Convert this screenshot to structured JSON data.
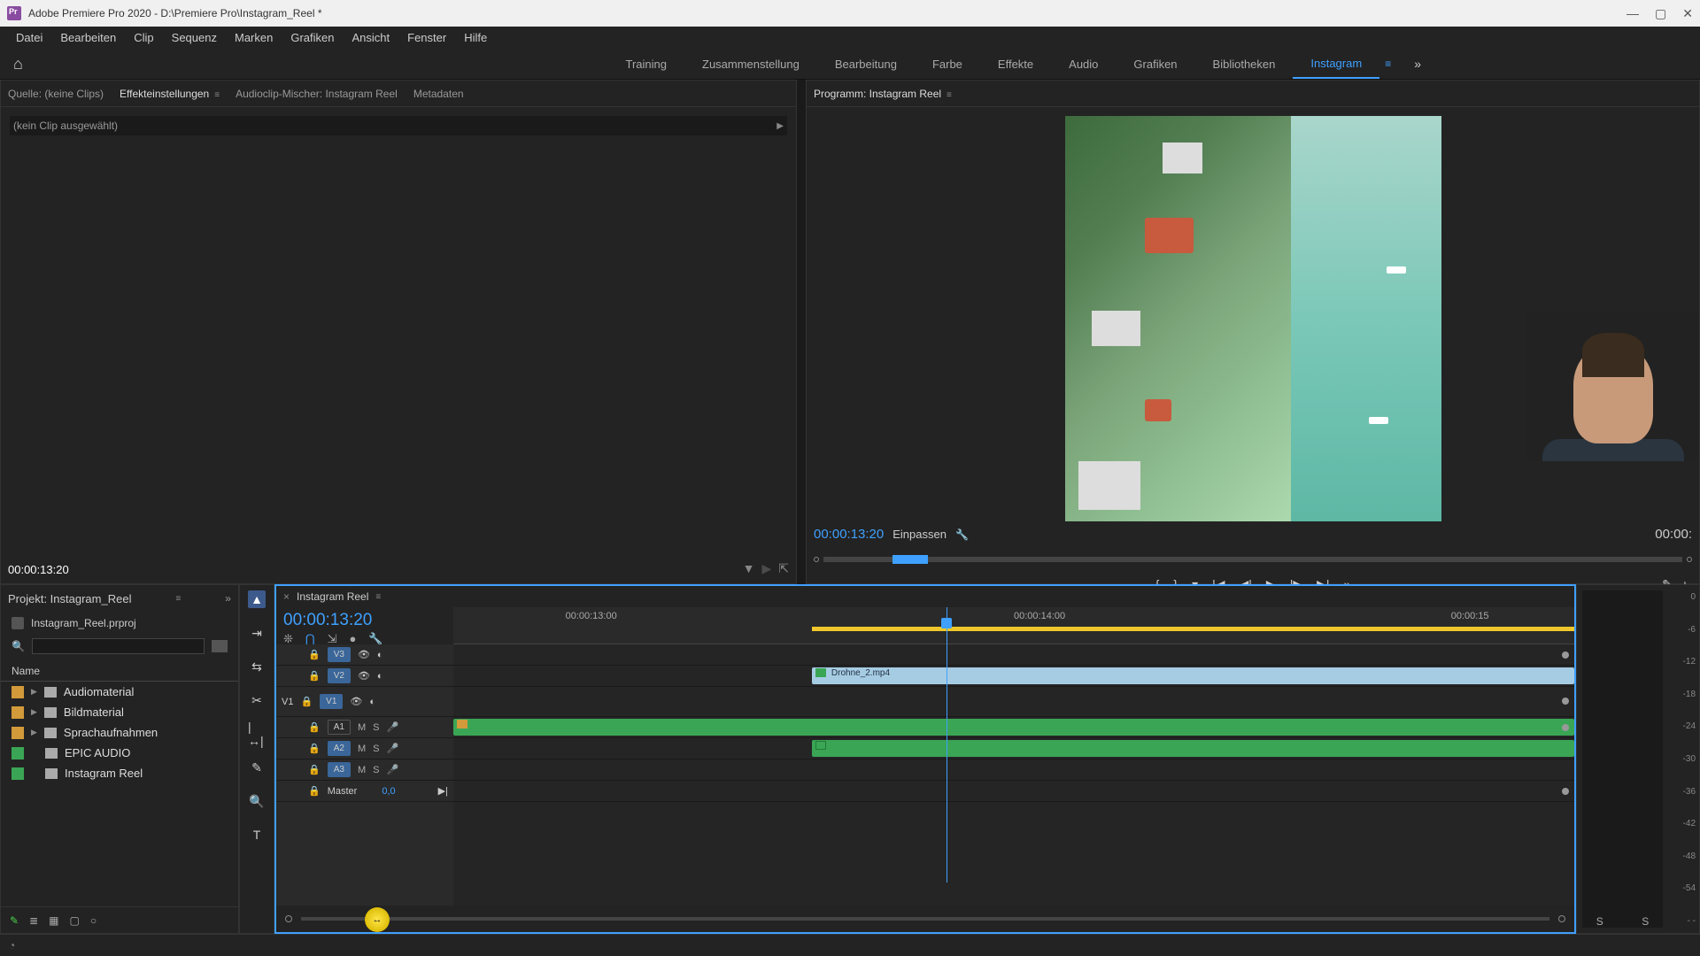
{
  "titlebar": {
    "title": "Adobe Premiere Pro 2020 - D:\\Premiere Pro\\Instagram_Reel *"
  },
  "menubar": [
    "Datei",
    "Bearbeiten",
    "Clip",
    "Sequenz",
    "Marken",
    "Grafiken",
    "Ansicht",
    "Fenster",
    "Hilfe"
  ],
  "workspaces": {
    "items": [
      "Training",
      "Zusammenstellung",
      "Bearbeitung",
      "Farbe",
      "Effekte",
      "Audio",
      "Grafiken",
      "Bibliotheken",
      "Instagram"
    ],
    "active": "Instagram"
  },
  "source": {
    "tabs": [
      "Quelle: (keine Clips)",
      "Effekteinstellungen",
      "Audioclip-Mischer: Instagram Reel",
      "Metadaten"
    ],
    "active_idx": 1,
    "noclip": "(kein Clip ausgewählt)",
    "time": "00:00:13:20"
  },
  "program": {
    "title": "Programm: Instagram Reel",
    "time": "00:00:13:20",
    "fit": "Einpassen",
    "endtime": "00:00:"
  },
  "project": {
    "tab": "Projekt: Instagram_Reel",
    "file": "Instagram_Reel.prproj",
    "name_header": "Name",
    "items": [
      {
        "swatch": "sw-orange",
        "type": "folder",
        "label": "Audiomaterial",
        "expandable": true
      },
      {
        "swatch": "sw-orange",
        "type": "folder",
        "label": "Bildmaterial",
        "expandable": true
      },
      {
        "swatch": "sw-orange",
        "type": "folder",
        "label": "Sprachaufnahmen",
        "expandable": true
      },
      {
        "swatch": "sw-green",
        "type": "seq",
        "label": "EPIC AUDIO",
        "expandable": false
      },
      {
        "swatch": "sw-green",
        "type": "seq",
        "label": "Instagram Reel",
        "expandable": false
      }
    ]
  },
  "timeline": {
    "seq_name": "Instagram Reel",
    "time": "00:00:13:20",
    "ruler": [
      "00:00:13:00",
      "00:00:14:00",
      "00:00:15"
    ],
    "video_tracks": [
      {
        "id": "V3",
        "sel": true
      },
      {
        "id": "V2",
        "sel": true
      },
      {
        "id": "V1",
        "sel": true,
        "targ": "V1"
      }
    ],
    "audio_tracks": [
      {
        "id": "A1",
        "sel": false
      },
      {
        "id": "A2",
        "sel": true
      },
      {
        "id": "A3",
        "sel": true
      }
    ],
    "master": {
      "label": "Master",
      "val": "0,0"
    },
    "clips": {
      "v2": {
        "name": "Drohne_2.mp4"
      }
    }
  },
  "meters": {
    "marks": [
      "0",
      "-6",
      "-12",
      "-18",
      "-24",
      "-30",
      "-36",
      "-42",
      "-48",
      "-54",
      "- -"
    ],
    "solo": "S"
  }
}
